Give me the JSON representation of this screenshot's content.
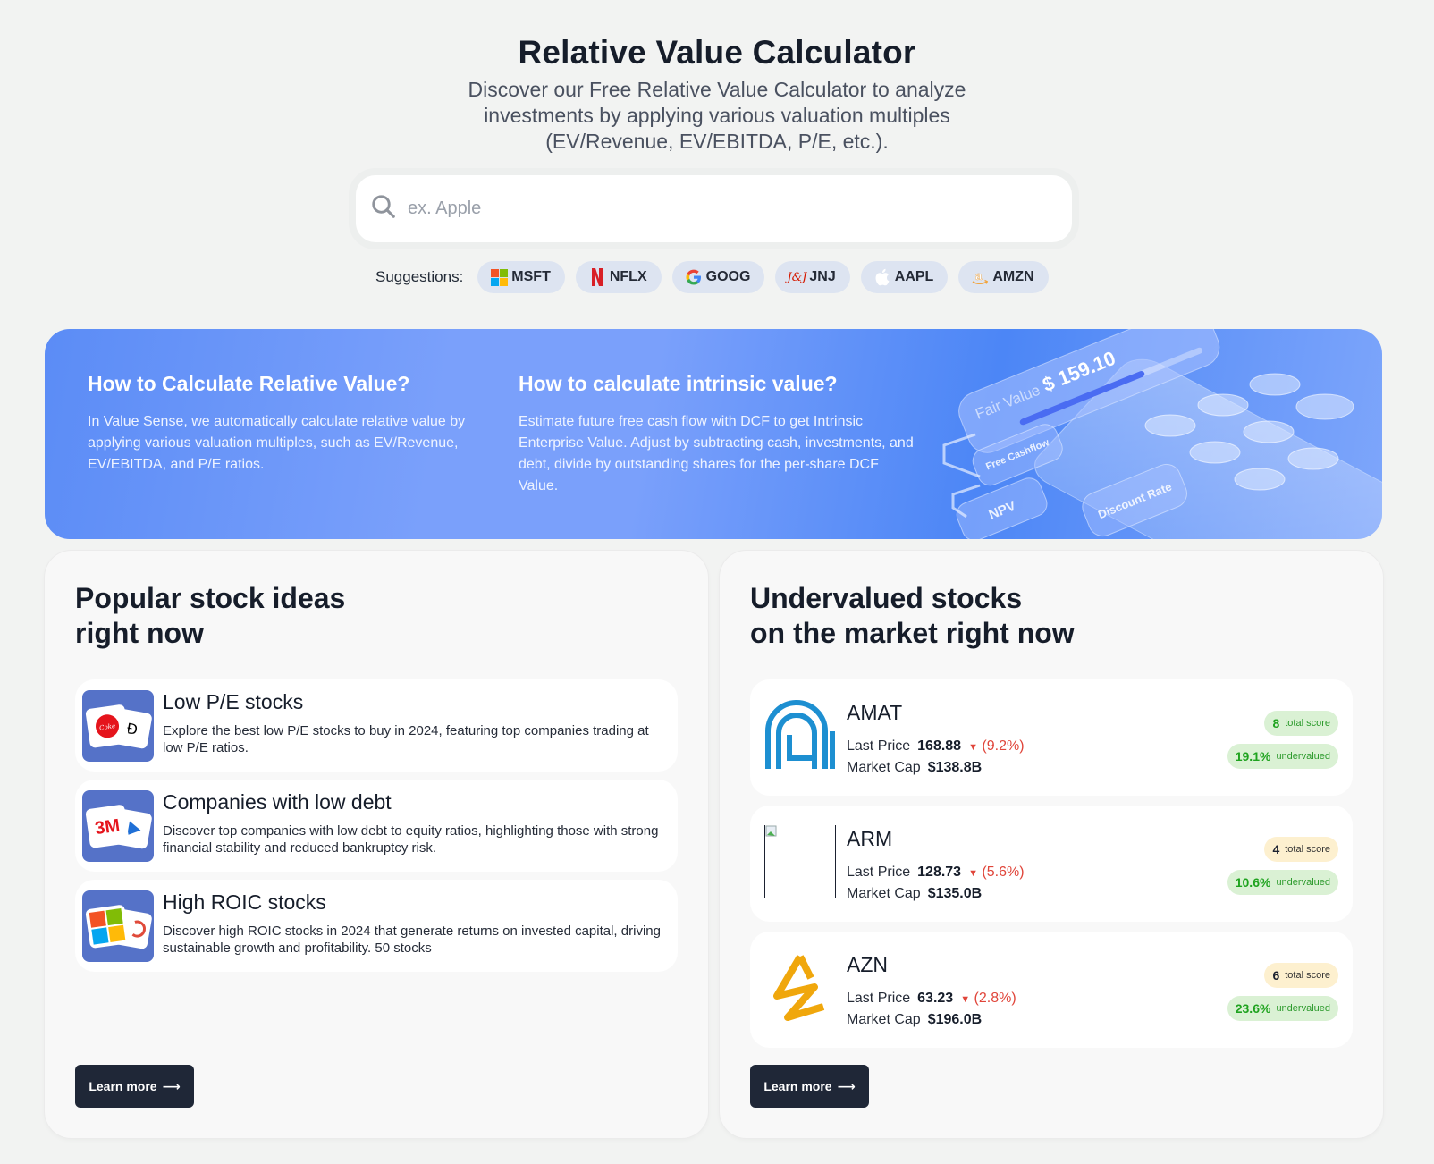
{
  "header": {
    "title": "Relative Value Calculator",
    "subtitle": "Discover our Free Relative Value Calculator to analyze investments by applying various valuation multiples (EV/Revenue, EV/EBITDA, P/E, etc.)."
  },
  "search": {
    "placeholder": "ex. Apple",
    "value": "",
    "icon": "search-icon"
  },
  "suggestions": {
    "label": "Suggestions:",
    "items": [
      {
        "ticker": "MSFT",
        "icon": "microsoft-logo-icon"
      },
      {
        "ticker": "NFLX",
        "icon": "netflix-logo-icon"
      },
      {
        "ticker": "GOOG",
        "icon": "google-logo-icon"
      },
      {
        "ticker": "JNJ",
        "icon": "jnj-logo-icon"
      },
      {
        "ticker": "AAPL",
        "icon": "apple-logo-icon"
      },
      {
        "ticker": "AMZN",
        "icon": "amazon-logo-icon"
      }
    ]
  },
  "banner": {
    "left": {
      "title": "How to Calculate Relative Value?",
      "body": "In Value Sense, we automatically calculate relative value by applying various valuation multiples, such as EV/Revenue, EV/EBITDA, and P/E ratios."
    },
    "right": {
      "title": "How to calculate intrinsic value?",
      "body": "Estimate future free cash flow with DCF to get Intrinsic Enterprise Value. Adjust by subtracting cash, investments, and debt, divide by outstanding shares for the per-share DCF Value."
    },
    "illustration": {
      "fair_value_label": "Fair Value",
      "fair_value": "$ 159.10",
      "tags": [
        "Free Cashflow",
        "NPV",
        "Discount Rate"
      ]
    }
  },
  "popular": {
    "title_line1": "Popular stock ideas",
    "title_line2": "right now",
    "items": [
      {
        "title": "Low P/E stocks",
        "desc": "Explore the best low P/E stocks to buy in 2024, featuring top companies trading at low P/E ratios."
      },
      {
        "title": "Companies with low debt",
        "desc": "Discover top companies with low debt to equity ratios, highlighting those with strong financial stability and reduced bankruptcy risk."
      },
      {
        "title": "High ROIC stocks",
        "desc": "Discover high ROIC stocks in 2024 that generate returns on invested capital, driving sustainable growth and profitability. 50 stocks"
      }
    ],
    "button": "Learn more"
  },
  "undervalued": {
    "title_line1": "Undervalued stocks",
    "title_line2": "on the market right now",
    "last_price_label": "Last Price",
    "market_cap_label": "Market Cap",
    "score_label": "total score",
    "undervalued_label": "undervalued",
    "stocks": [
      {
        "ticker": "AMAT",
        "price": "168.88",
        "change": "(9.2%)",
        "market_cap": "$138.8B",
        "score": "8",
        "score_level": "good",
        "undervalued": "19.1%"
      },
      {
        "ticker": "ARM",
        "price": "128.73",
        "change": "(5.6%)",
        "market_cap": "$135.0B",
        "score": "4",
        "score_level": "medium",
        "undervalued": "10.6%"
      },
      {
        "ticker": "AZN",
        "price": "63.23",
        "change": "(2.8%)",
        "market_cap": "$196.0B",
        "score": "6",
        "score_level": "medium",
        "undervalued": "23.6%"
      }
    ],
    "button": "Learn more"
  },
  "colors": {
    "accent_dark": "#1f2737",
    "banner_blue": "#5b8cf6",
    "negative": "#e0453a",
    "positive": "#1fa31f"
  }
}
